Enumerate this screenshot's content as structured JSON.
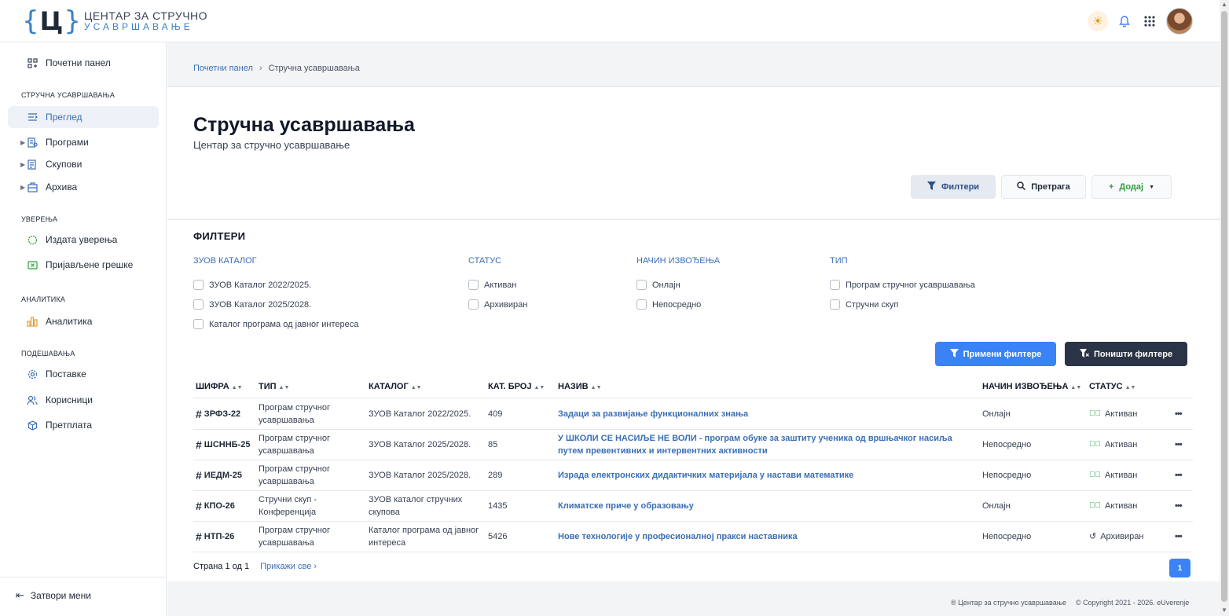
{
  "brand": {
    "line1": "ЦЕНТАР ЗА СТРУЧНО",
    "line2": "УСАВРШАВАЊЕ",
    "mark": "Ц"
  },
  "sidebar": {
    "dashboard": "Почетни панел",
    "sections": [
      {
        "title": "СТРУЧНА УСАВРШАВАЊА",
        "items": [
          "Преглед",
          "Програми",
          "Скупови",
          "Архива"
        ]
      },
      {
        "title": "УВЕРЕЊА",
        "items": [
          "Издата уверења",
          "Пријављене грешке"
        ]
      },
      {
        "title": "АНАЛИТИКА",
        "items": [
          "Аналитика"
        ]
      },
      {
        "title": "ПОДЕШАВАЊА",
        "items": [
          "Поставке",
          "Корисници",
          "Претплата"
        ]
      }
    ],
    "close": "Затвори мени"
  },
  "breadcrumb": {
    "home": "Почетни панел",
    "current": "Стручна усавршавања"
  },
  "page": {
    "title": "Стручна усавршавања",
    "subtitle": "Центар за стручно усавршавање"
  },
  "toolbar": {
    "filters": "Филтери",
    "search": "Претрага",
    "add": "Додај"
  },
  "filters": {
    "title": "ФИЛТЕРИ",
    "groups": [
      {
        "title": "ЗУОВ КАТАЛОГ",
        "options": [
          "ЗУОВ Каталог 2022/2025.",
          "ЗУОВ Каталог 2025/2028.",
          "Каталог програма од јавног интереса"
        ]
      },
      {
        "title": "СТАТУС",
        "options": [
          "Активан",
          "Архивиран"
        ]
      },
      {
        "title": "НАЧИН ИЗВОЂЕЊА",
        "options": [
          "Онлајн",
          "Непосредно"
        ]
      },
      {
        "title": "ТИП",
        "options": [
          "Програм стручног усавршавања",
          "Стручни скуп"
        ]
      }
    ],
    "apply": "Примени филтере",
    "reset": "Поништи филтере"
  },
  "table": {
    "columns": [
      "ШИФРА",
      "ТИП",
      "КАТАЛОГ",
      "КАТ. БРОЈ",
      "НАЗИВ",
      "НАЧИН ИЗВОЂЕЊА",
      "СТАТУС"
    ],
    "rows": [
      {
        "code": "ЗРФЗ-22",
        "type": "Програм стручног усавршавања",
        "catalog": "ЗУОВ Каталог 2022/2025.",
        "num": "409",
        "name": "Задаци за развијање функционалних знања",
        "mode": "Онлајн",
        "status": "Активан"
      },
      {
        "code": "ШСННБ-25",
        "type": "Програм стручног усавршавања",
        "catalog": "ЗУОВ Каталог 2025/2028.",
        "num": "85",
        "name": "У ШКОЛИ СЕ НАСИЉЕ НЕ ВОЛИ - програм обуке за заштиту ученика од вршњачког насиља путем превентивних и интервентних активности",
        "mode": "Непосредно",
        "status": "Активан"
      },
      {
        "code": "ИЕДМ-25",
        "type": "Програм стручног усавршавања",
        "catalog": "ЗУОВ Каталог 2025/2028.",
        "num": "289",
        "name": "Израда електронских дидактичких материјала у настави математике",
        "mode": "Непосредно",
        "status": "Активан"
      },
      {
        "code": "КПО-26",
        "type": "Стручни скуп - Конференција",
        "catalog": "ЗУОВ каталог стручних скупова",
        "num": "1435",
        "name": "Климатске приче у образовању",
        "mode": "Онлајн",
        "status": "Активан"
      },
      {
        "code": "НТП-26",
        "type": "Програм стручног усавршавања",
        "catalog": "Каталог програма од јавног интереса",
        "num": "5426",
        "name": "Нове технологије у професионалној пракси наставника",
        "mode": "Непосредно",
        "status": "Архивиран"
      }
    ]
  },
  "pager": {
    "info": "Страна 1 од 1",
    "show_all": "Прикажи све",
    "page": "1"
  },
  "footer": {
    "org": "Центар за стручно усавршавање",
    "copyright": "Copyright 2021 - 2026.",
    "brand": "eUverenje"
  },
  "colors": {
    "accent": "#3b82f6",
    "link": "#3b6fb6",
    "dark": "#2b3446",
    "success": "#22a34a"
  }
}
